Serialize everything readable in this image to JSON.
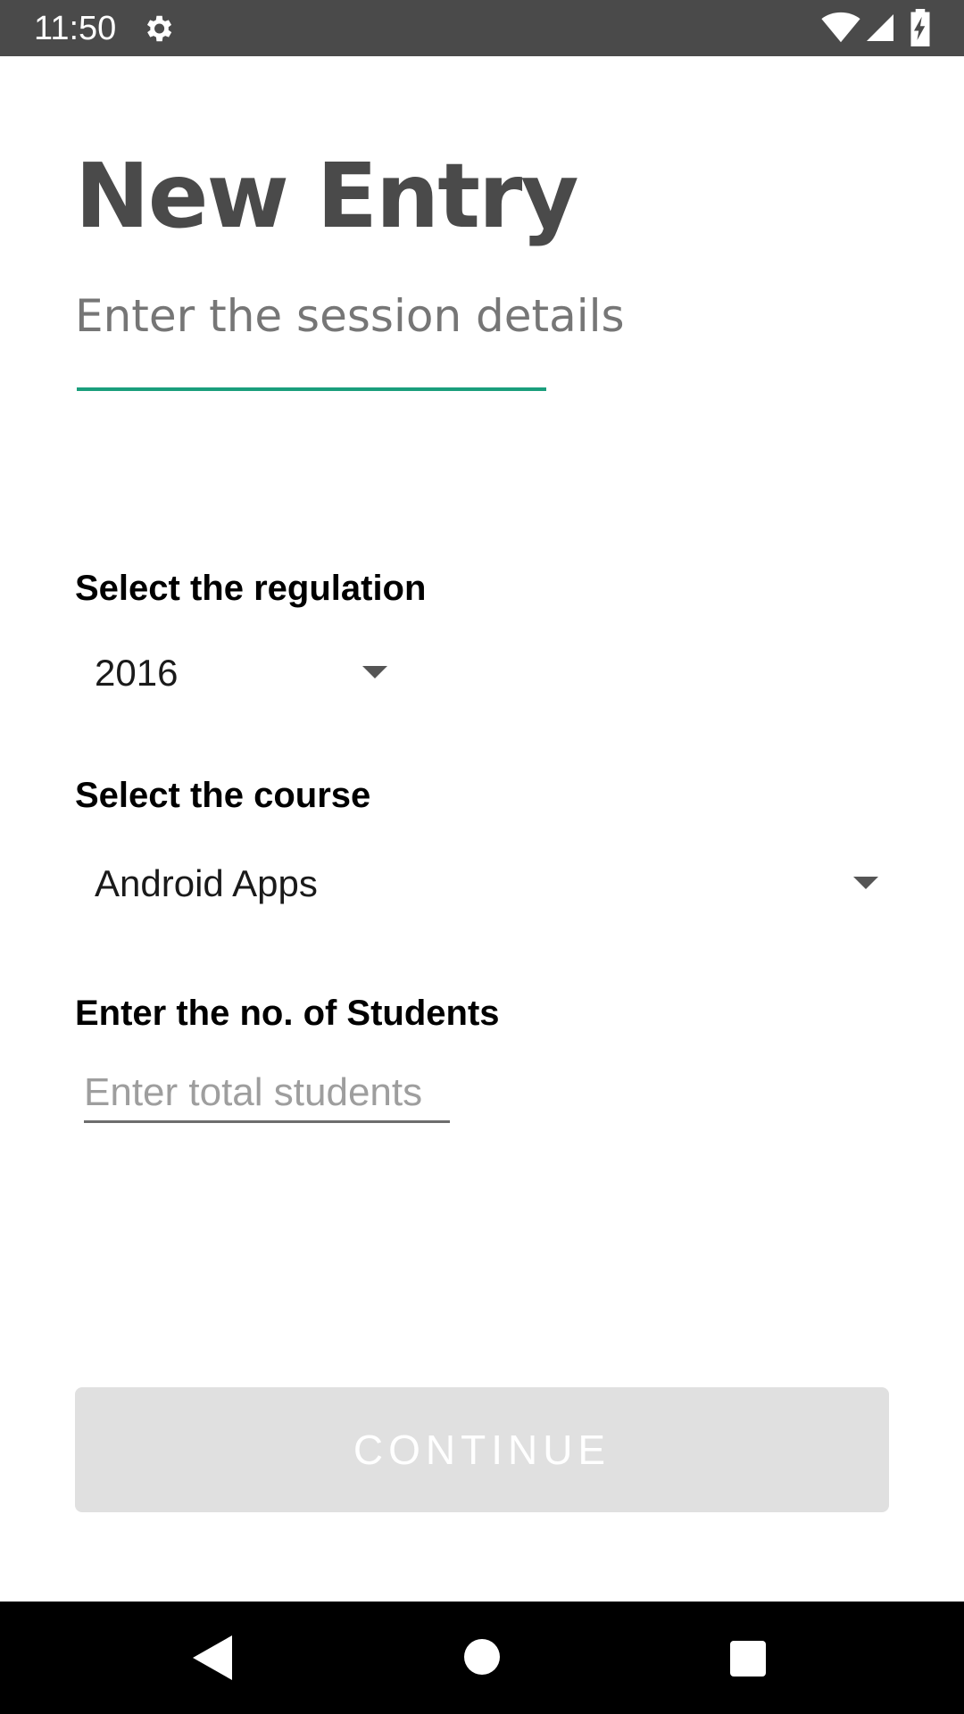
{
  "status_bar": {
    "time": "11:50",
    "icons": [
      "gear-icon",
      "wifi-icon",
      "signal-icon",
      "battery-charging-icon"
    ]
  },
  "header": {
    "title": "New Entry",
    "subtitle": "Enter the session details",
    "accent_color": "#1a9e7c"
  },
  "form": {
    "regulation": {
      "label": "Select the regulation",
      "selected": "2016"
    },
    "course": {
      "label": "Select the course",
      "selected": "Android Apps"
    },
    "students": {
      "label": "Enter the no. of Students",
      "value": "",
      "placeholder": "Enter total students"
    }
  },
  "actions": {
    "continue_label": "CONTINUE",
    "continue_enabled": false
  },
  "nav_bar": {
    "icons": [
      "back-icon",
      "home-icon",
      "recents-icon"
    ]
  }
}
